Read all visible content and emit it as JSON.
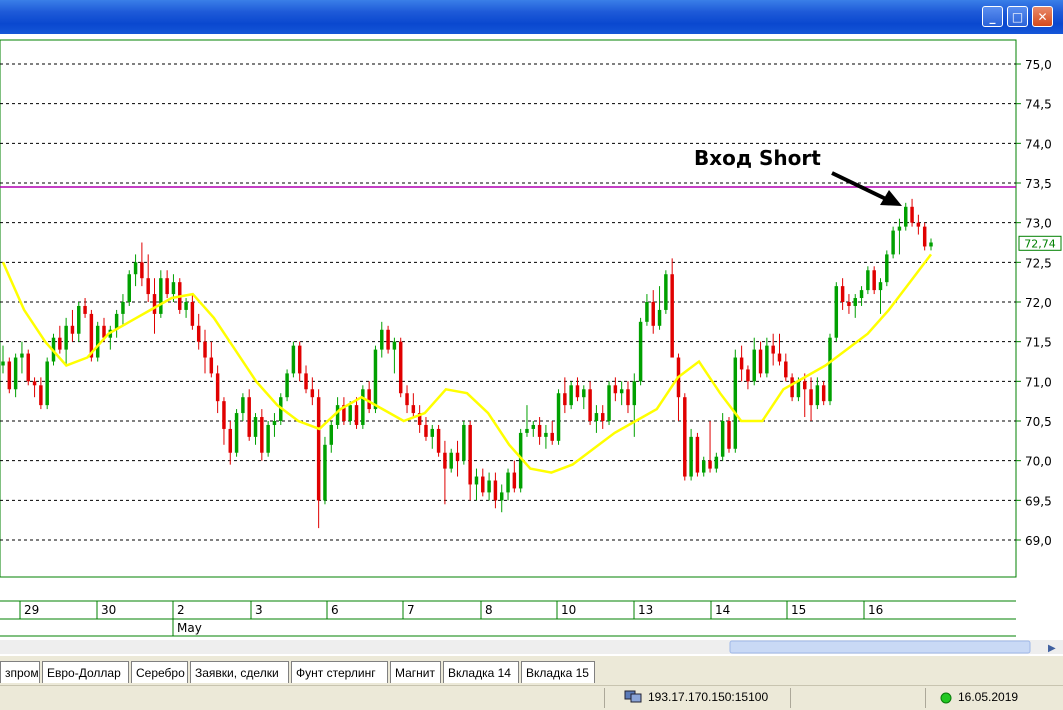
{
  "window": {
    "buttons": {
      "minimize": "_",
      "maximize": "□",
      "close": "✕"
    }
  },
  "chart_data": {
    "type": "candlestick",
    "ylim": [
      68.7,
      75.3
    ],
    "y_ticks": [
      "75,0",
      "74,5",
      "74,0",
      "73,5",
      "73,0",
      "72,5",
      "72,0",
      "71,5",
      "71,0",
      "70,5",
      "70,0",
      "69,5",
      "69,0"
    ],
    "x_tick_labels": [
      "29",
      "30",
      "2",
      "3",
      "6",
      "7",
      "8",
      "10",
      "13",
      "14",
      "15",
      "16"
    ],
    "month_label": "May",
    "last_price": "72,74",
    "resistance_level": 73.45,
    "annotation": "Вход Short",
    "colors": {
      "up": "#00a000",
      "down": "#e00000",
      "ma": "#ffff00",
      "level": "#b000b0",
      "grid": "#000000",
      "frame": "#008000"
    },
    "candles": [
      [
        71.2,
        71.45,
        71.1,
        71.25
      ],
      [
        71.25,
        71.3,
        70.85,
        70.9
      ],
      [
        70.9,
        71.35,
        70.8,
        71.3
      ],
      [
        71.3,
        71.5,
        71.1,
        71.35
      ],
      [
        71.35,
        71.4,
        70.95,
        71.0
      ],
      [
        71.0,
        71.05,
        70.8,
        70.95
      ],
      [
        70.95,
        71.05,
        70.65,
        70.7
      ],
      [
        70.7,
        71.3,
        70.65,
        71.25
      ],
      [
        71.25,
        71.6,
        71.2,
        71.55
      ],
      [
        71.55,
        71.7,
        71.35,
        71.4
      ],
      [
        71.4,
        71.8,
        71.2,
        71.7
      ],
      [
        71.7,
        71.9,
        71.5,
        71.6
      ],
      [
        71.6,
        72.0,
        71.5,
        71.95
      ],
      [
        71.95,
        72.05,
        71.8,
        71.85
      ],
      [
        71.85,
        71.9,
        71.25,
        71.3
      ],
      [
        71.3,
        71.75,
        71.25,
        71.7
      ],
      [
        71.7,
        71.8,
        71.5,
        71.55
      ],
      [
        71.55,
        71.7,
        71.4,
        71.65
      ],
      [
        71.65,
        71.9,
        71.55,
        71.85
      ],
      [
        71.85,
        72.1,
        71.7,
        72.0
      ],
      [
        72.0,
        72.4,
        71.95,
        72.35
      ],
      [
        72.35,
        72.6,
        72.2,
        72.5
      ],
      [
        72.5,
        72.75,
        72.2,
        72.3
      ],
      [
        72.3,
        72.6,
        72.0,
        72.1
      ],
      [
        72.1,
        72.3,
        71.6,
        71.85
      ],
      [
        71.85,
        72.4,
        71.8,
        72.3
      ],
      [
        72.3,
        72.4,
        72.05,
        72.1
      ],
      [
        72.1,
        72.35,
        72.0,
        72.25
      ],
      [
        72.25,
        72.3,
        71.85,
        71.9
      ],
      [
        71.9,
        72.05,
        71.8,
        72.0
      ],
      [
        72.0,
        72.1,
        71.65,
        71.7
      ],
      [
        71.7,
        71.85,
        71.4,
        71.5
      ],
      [
        71.5,
        71.65,
        71.1,
        71.3
      ],
      [
        71.3,
        71.5,
        71.05,
        71.1
      ],
      [
        71.1,
        71.2,
        70.6,
        70.75
      ],
      [
        70.75,
        70.8,
        70.2,
        70.4
      ],
      [
        70.4,
        70.5,
        69.95,
        70.1
      ],
      [
        70.1,
        70.65,
        70.05,
        70.6
      ],
      [
        70.6,
        70.85,
        70.5,
        70.8
      ],
      [
        70.8,
        70.9,
        70.25,
        70.3
      ],
      [
        70.3,
        70.6,
        70.2,
        70.55
      ],
      [
        70.55,
        70.65,
        70.0,
        70.1
      ],
      [
        70.1,
        70.5,
        70.05,
        70.45
      ],
      [
        70.45,
        70.6,
        70.3,
        70.5
      ],
      [
        70.5,
        70.85,
        70.45,
        70.8
      ],
      [
        70.8,
        71.15,
        70.75,
        71.1
      ],
      [
        71.1,
        71.5,
        71.05,
        71.45
      ],
      [
        71.45,
        71.5,
        71.0,
        71.1
      ],
      [
        71.1,
        71.2,
        70.85,
        70.9
      ],
      [
        70.9,
        71.05,
        70.7,
        70.8
      ],
      [
        70.8,
        70.9,
        69.15,
        69.5
      ],
      [
        69.5,
        70.3,
        69.45,
        70.2
      ],
      [
        70.2,
        70.5,
        70.1,
        70.45
      ],
      [
        70.45,
        70.8,
        70.4,
        70.7
      ],
      [
        70.7,
        70.8,
        70.45,
        70.5
      ],
      [
        70.5,
        70.75,
        70.45,
        70.7
      ],
      [
        70.7,
        70.8,
        70.4,
        70.45
      ],
      [
        70.45,
        70.95,
        70.4,
        70.9
      ],
      [
        70.9,
        71.0,
        70.6,
        70.65
      ],
      [
        70.65,
        71.45,
        70.6,
        71.4
      ],
      [
        71.4,
        71.75,
        71.3,
        71.65
      ],
      [
        71.65,
        71.7,
        71.35,
        71.4
      ],
      [
        71.4,
        71.55,
        71.1,
        71.5
      ],
      [
        71.5,
        71.55,
        70.8,
        70.85
      ],
      [
        70.85,
        70.95,
        70.6,
        70.7
      ],
      [
        70.7,
        70.85,
        70.55,
        70.6
      ],
      [
        70.6,
        70.7,
        70.35,
        70.45
      ],
      [
        70.45,
        70.55,
        70.25,
        70.3
      ],
      [
        70.3,
        70.45,
        70.15,
        70.4
      ],
      [
        70.4,
        70.45,
        70.05,
        70.1
      ],
      [
        70.1,
        70.25,
        69.45,
        69.9
      ],
      [
        69.9,
        70.15,
        69.85,
        70.1
      ],
      [
        70.1,
        70.25,
        69.8,
        70.0
      ],
      [
        70.0,
        70.5,
        69.95,
        70.45
      ],
      [
        70.45,
        70.5,
        69.5,
        69.7
      ],
      [
        69.7,
        69.9,
        69.5,
        69.8
      ],
      [
        69.8,
        69.9,
        69.55,
        69.6
      ],
      [
        69.6,
        69.85,
        69.5,
        69.75
      ],
      [
        69.75,
        69.85,
        69.4,
        69.5
      ],
      [
        69.5,
        69.7,
        69.35,
        69.6
      ],
      [
        69.6,
        69.9,
        69.5,
        69.85
      ],
      [
        69.85,
        70.0,
        69.6,
        69.65
      ],
      [
        69.65,
        70.4,
        69.6,
        70.35
      ],
      [
        70.35,
        70.7,
        70.3,
        70.4
      ],
      [
        70.4,
        70.5,
        70.3,
        70.45
      ],
      [
        70.45,
        70.55,
        70.2,
        70.3
      ],
      [
        70.3,
        70.45,
        70.15,
        70.35
      ],
      [
        70.35,
        70.5,
        70.2,
        70.25
      ],
      [
        70.25,
        70.9,
        70.2,
        70.85
      ],
      [
        70.85,
        71.05,
        70.6,
        70.7
      ],
      [
        70.7,
        71.0,
        70.65,
        70.95
      ],
      [
        70.95,
        71.05,
        70.75,
        70.8
      ],
      [
        70.8,
        70.95,
        70.65,
        70.9
      ],
      [
        70.9,
        71.0,
        70.45,
        70.5
      ],
      [
        70.5,
        70.7,
        70.35,
        70.6
      ],
      [
        70.6,
        70.7,
        70.4,
        70.5
      ],
      [
        70.5,
        71.0,
        70.45,
        70.95
      ],
      [
        70.95,
        71.05,
        70.75,
        70.85
      ],
      [
        70.85,
        71.0,
        70.7,
        70.9
      ],
      [
        70.9,
        71.0,
        70.6,
        70.7
      ],
      [
        70.7,
        71.1,
        70.3,
        71.0
      ],
      [
        71.0,
        71.8,
        70.95,
        71.75
      ],
      [
        71.75,
        72.1,
        71.7,
        72.0
      ],
      [
        72.0,
        72.15,
        71.6,
        71.7
      ],
      [
        71.7,
        72.2,
        71.65,
        71.9
      ],
      [
        71.9,
        72.4,
        71.85,
        72.35
      ],
      [
        72.35,
        72.55,
        71.5,
        71.3
      ],
      [
        71.3,
        71.35,
        70.5,
        70.8
      ],
      [
        70.8,
        70.85,
        69.75,
        69.8
      ],
      [
        69.8,
        70.4,
        69.75,
        70.3
      ],
      [
        70.3,
        70.35,
        69.8,
        69.85
      ],
      [
        69.85,
        70.05,
        69.8,
        70.0
      ],
      [
        70.0,
        70.5,
        69.85,
        69.9
      ],
      [
        69.9,
        70.1,
        69.85,
        70.05
      ],
      [
        70.05,
        70.6,
        70.0,
        70.5
      ],
      [
        70.5,
        70.55,
        70.1,
        70.15
      ],
      [
        70.15,
        71.4,
        70.1,
        71.3
      ],
      [
        71.3,
        71.45,
        71.0,
        71.15
      ],
      [
        71.15,
        71.2,
        70.9,
        71.0
      ],
      [
        71.0,
        71.55,
        70.95,
        71.4
      ],
      [
        71.4,
        71.5,
        71.05,
        71.1
      ],
      [
        71.1,
        71.55,
        71.05,
        71.45
      ],
      [
        71.45,
        71.6,
        71.2,
        71.35
      ],
      [
        71.35,
        71.6,
        71.2,
        71.25
      ],
      [
        71.25,
        71.35,
        71.0,
        71.05
      ],
      [
        71.05,
        71.1,
        70.75,
        70.8
      ],
      [
        70.8,
        71.05,
        70.75,
        71.0
      ],
      [
        71.0,
        71.1,
        70.55,
        70.9
      ],
      [
        70.9,
        71.05,
        70.5,
        70.7
      ],
      [
        70.7,
        71.05,
        70.65,
        70.95
      ],
      [
        70.95,
        71.0,
        70.7,
        70.75
      ],
      [
        70.75,
        71.6,
        70.7,
        71.55
      ],
      [
        71.55,
        72.25,
        71.5,
        72.2
      ],
      [
        72.2,
        72.3,
        71.9,
        72.0
      ],
      [
        72.0,
        72.1,
        71.85,
        71.95
      ],
      [
        71.95,
        72.1,
        71.8,
        72.05
      ],
      [
        72.05,
        72.2,
        71.95,
        72.15
      ],
      [
        72.15,
        72.45,
        72.1,
        72.4
      ],
      [
        72.4,
        72.45,
        72.1,
        72.15
      ],
      [
        72.15,
        72.3,
        71.85,
        72.25
      ],
      [
        72.25,
        72.65,
        72.2,
        72.6
      ],
      [
        72.6,
        72.95,
        72.55,
        72.9
      ],
      [
        72.9,
        73.05,
        72.6,
        72.95
      ],
      [
        72.95,
        73.25,
        72.9,
        73.2
      ],
      [
        73.2,
        73.3,
        72.95,
        73.0
      ],
      [
        73.0,
        73.1,
        72.85,
        72.95
      ],
      [
        72.95,
        73.0,
        72.65,
        72.7
      ],
      [
        72.7,
        72.8,
        72.65,
        72.75
      ]
    ],
    "ma": [
      72.5,
      71.9,
      71.5,
      71.2,
      71.3,
      71.6,
      71.75,
      71.9,
      72.05,
      72.1,
      71.8,
      71.4,
      71.0,
      70.7,
      70.5,
      70.4,
      70.65,
      70.8,
      70.65,
      70.5,
      70.6,
      70.9,
      70.85,
      70.6,
      70.2,
      69.9,
      69.85,
      69.95,
      70.15,
      70.35,
      70.5,
      70.65,
      71.05,
      71.25,
      70.85,
      70.5,
      70.5,
      70.9,
      71.05,
      71.2,
      71.4,
      71.6,
      71.9,
      72.25,
      72.6
    ],
    "ma_x": [
      0,
      10,
      20,
      30,
      40,
      50,
      60,
      70,
      80,
      90,
      100,
      110,
      120,
      130,
      140,
      150,
      160,
      170,
      180,
      190,
      200,
      210,
      220,
      230,
      240,
      250,
      260,
      270,
      280,
      290,
      300,
      310,
      320,
      330,
      340,
      350,
      360,
      370,
      380,
      390,
      400,
      410,
      420,
      430,
      440
    ]
  },
  "tabs": [
    "зпром",
    "Евро-Доллар",
    "Серебро",
    "Заявки, сделки",
    "Фунт стерлинг",
    "Магнит",
    "Вкладка 14",
    "Вкладка 15"
  ],
  "status": {
    "server": "193.17.170.150:15100",
    "date": "16.05.2019"
  }
}
